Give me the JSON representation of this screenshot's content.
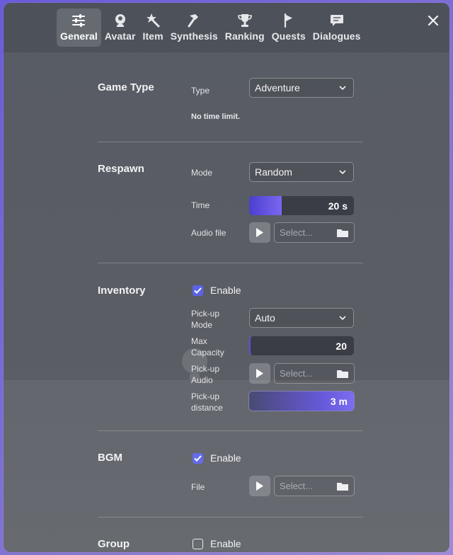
{
  "tabs": [
    {
      "label": "General",
      "icon": "sliders-icon",
      "active": true
    },
    {
      "label": "Avatar",
      "icon": "avatar-icon",
      "active": false
    },
    {
      "label": "Item",
      "icon": "magic-wand-icon",
      "active": false
    },
    {
      "label": "Synthesis",
      "icon": "hammer-icon",
      "active": false
    },
    {
      "label": "Ranking",
      "icon": "trophy-icon",
      "active": false
    },
    {
      "label": "Quests",
      "icon": "flag-icon",
      "active": false
    },
    {
      "label": "Dialogues",
      "icon": "chat-bubble-icon",
      "active": false
    }
  ],
  "game_type": {
    "title": "Game Type",
    "type_label": "Type",
    "type_value": "Adventure",
    "note": "No time limit."
  },
  "respawn": {
    "title": "Respawn",
    "mode_label": "Mode",
    "mode_value": "Random",
    "time_label": "Time",
    "time_value": "20 s",
    "time_fraction": 0.31,
    "audio_label": "Audio file",
    "audio_placeholder": "Select..."
  },
  "inventory": {
    "title": "Inventory",
    "enable_label": "Enable",
    "enabled": true,
    "pickup_mode_label_1": "Pick-up",
    "pickup_mode_label_2": "Mode",
    "pickup_mode_value": "Auto",
    "max_capacity_label_1": "Max",
    "max_capacity_label_2": "Capacity",
    "max_capacity_value": "20",
    "pickup_audio_label_1": "Pick-up",
    "pickup_audio_label_2": "Audio",
    "pickup_audio_placeholder": "Select...",
    "pickup_distance_label_1": "Pick-up",
    "pickup_distance_label_2": "distance",
    "pickup_distance_value": "3 m",
    "pickup_distance_fraction": 1.0
  },
  "bgm": {
    "title": "BGM",
    "enable_label": "Enable",
    "enabled": true,
    "file_label": "File",
    "file_placeholder": "Select..."
  },
  "group": {
    "title": "Group",
    "enable_label": "Enable",
    "enabled": false
  },
  "colors": {
    "accent": "#5b63e8",
    "slider_fill": "#6a58e8"
  }
}
